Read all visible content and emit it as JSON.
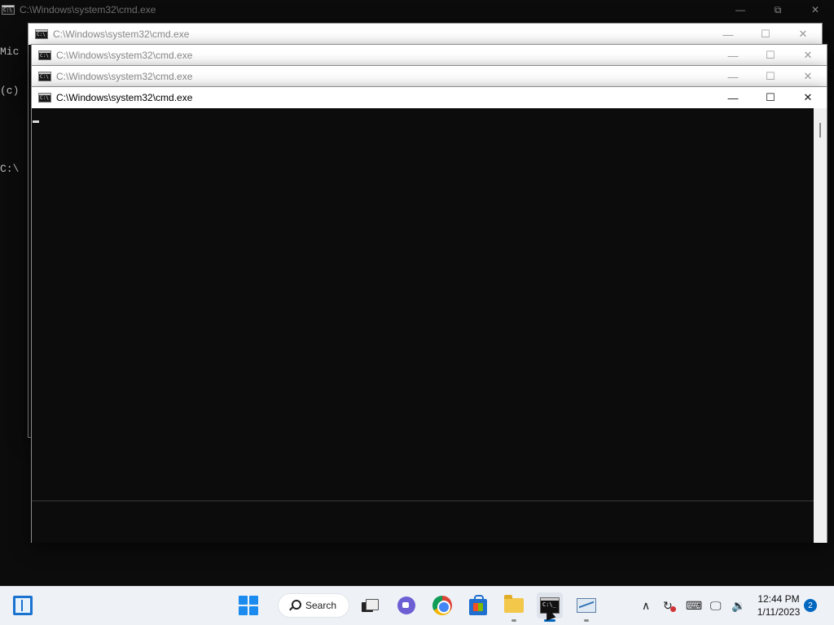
{
  "windows": {
    "base": {
      "title": "C:\\Windows\\system32\\cmd.exe",
      "console_lines": [
        "Mic",
        "(c)",
        "",
        "C:\\"
      ],
      "minimize": "—",
      "maximize": "⧉",
      "close": "✕"
    },
    "w1": {
      "title": "C:\\Windows\\system32\\cmd.exe"
    },
    "w2": {
      "title": "C:\\Windows\\system32\\cmd.exe"
    },
    "w3": {
      "title": "C:\\Windows\\system32\\cmd.exe"
    },
    "w4": {
      "title": "C:\\Windows\\system32\\cmd.exe"
    },
    "controls": {
      "minimize": "—",
      "maximize": "☐",
      "close": "✕"
    }
  },
  "taskbar": {
    "search_label": "Search",
    "items": [
      "widgets-icon",
      "start-icon",
      "search-icon",
      "task-view-icon",
      "chat-icon",
      "chrome-icon",
      "store-icon",
      "file-explorer-icon",
      "terminal-icon",
      "performance-monitor-icon"
    ],
    "tray": {
      "chevron": "∧",
      "keyboard": "⌨",
      "volume": "🔉"
    },
    "clock": {
      "time": "12:44 PM",
      "date": "1/11/2023"
    },
    "notifications": "2",
    "accent": "#0067c0"
  }
}
